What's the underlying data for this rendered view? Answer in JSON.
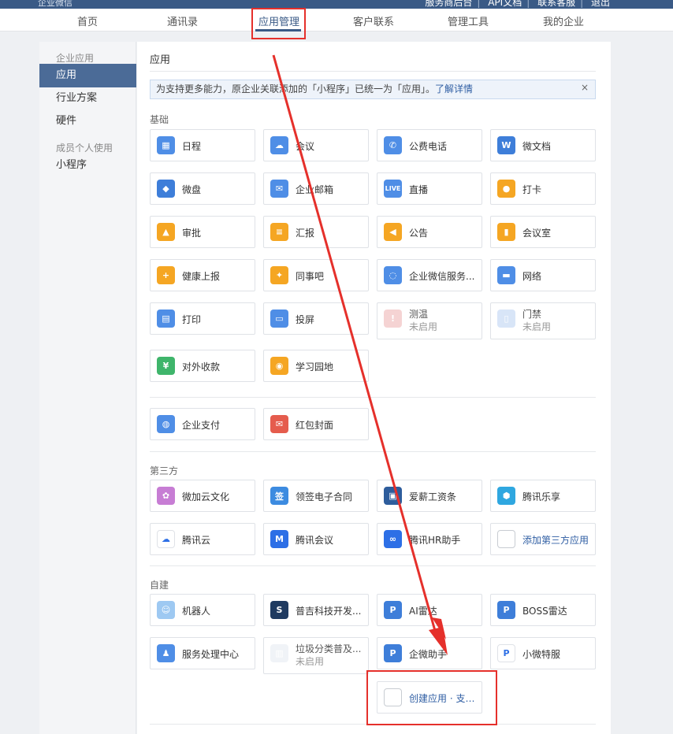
{
  "topbar": {
    "brand": "企业微信",
    "links": [
      "服务商后台",
      "API文档",
      "联系客服",
      "退出"
    ]
  },
  "nav": {
    "items": [
      "首页",
      "通讯录",
      "应用管理",
      "客户联系",
      "管理工具",
      "我的企业"
    ],
    "active": "应用管理"
  },
  "sidebar": {
    "group1": "企业应用",
    "items1": [
      "应用",
      "行业方案",
      "硬件"
    ],
    "group2": "成员个人使用",
    "items2": [
      "小程序"
    ]
  },
  "page": {
    "title": "应用",
    "notice_text": "为支持更多能力，原企业关联添加的「小程序」已统一为「应用」。",
    "notice_link": "了解详情",
    "notice_close": "×"
  },
  "sections": {
    "basic": "基础",
    "third": "第三方",
    "custom": "自建"
  },
  "apps": {
    "basic": [
      {
        "name": "日程",
        "icon": "calendar-icon",
        "color": "#4f8ee6"
      },
      {
        "name": "会议",
        "icon": "cloud-camera-icon",
        "color": "#4f8ee6"
      },
      {
        "name": "公费电话",
        "icon": "phone-icon",
        "color": "#4f8ee6"
      },
      {
        "name": "微文档",
        "icon": "doc-w-icon",
        "color": "#3e7ed9"
      },
      {
        "name": "微盘",
        "icon": "drive-icon",
        "color": "#3e7ed9"
      },
      {
        "name": "企业邮箱",
        "icon": "mail-icon",
        "color": "#4f8ee6"
      },
      {
        "name": "直播",
        "icon": "live-icon",
        "color": "#4f8ee6"
      },
      {
        "name": "打卡",
        "icon": "location-pin-icon",
        "color": "#f5a623"
      },
      {
        "name": "审批",
        "icon": "stamp-icon",
        "color": "#f5a623"
      },
      {
        "name": "汇报",
        "icon": "report-icon",
        "color": "#f5a623"
      },
      {
        "name": "公告",
        "icon": "megaphone-icon",
        "color": "#f5a623"
      },
      {
        "name": "会议室",
        "icon": "door-icon",
        "color": "#f5a623"
      },
      {
        "name": "健康上报",
        "icon": "health-report-icon",
        "color": "#f5a623"
      },
      {
        "name": "同事吧",
        "icon": "community-icon",
        "color": "#f5a623"
      },
      {
        "name": "企业微信服务...",
        "icon": "chat-service-icon",
        "color": "#4f8ee6"
      },
      {
        "name": "网络",
        "icon": "router-icon",
        "color": "#4f8ee6"
      },
      {
        "name": "打印",
        "icon": "printer-icon",
        "color": "#4f8ee6"
      },
      {
        "name": "投屏",
        "icon": "screencast-icon",
        "color": "#4f8ee6"
      },
      {
        "name": "测温",
        "sub": "未启用",
        "icon": "thermometer-icon",
        "color": "#e9a0a0"
      },
      {
        "name": "门禁",
        "sub": "未启用",
        "icon": "access-gate-icon",
        "color": "#a9c6ef"
      },
      {
        "name": "对外收款",
        "icon": "yuan-icon",
        "color": "#3fb56b"
      },
      {
        "name": "学习园地",
        "icon": "planet-icon",
        "color": "#f5a623"
      }
    ],
    "pay": [
      {
        "name": "企业支付",
        "icon": "wallet-icon",
        "color": "#4f8ee6"
      },
      {
        "name": "红包封面",
        "icon": "red-envelope-icon",
        "color": "#e55c4d"
      }
    ],
    "third": [
      {
        "name": "微加云文化",
        "icon": "flower-icon",
        "color": "#c77dd4"
      },
      {
        "name": "领签电子合同",
        "icon": "contract-icon",
        "color": "#3c8be0"
      },
      {
        "name": "爱薪工资条",
        "icon": "payslip-icon",
        "color": "#2e5d9c"
      },
      {
        "name": "腾讯乐享",
        "icon": "hexagon-icon",
        "color": "#2fa7e0"
      },
      {
        "name": "腾讯云",
        "icon": "tencent-cloud-icon",
        "color": "#ffffff"
      },
      {
        "name": "腾讯会议",
        "icon": "tencent-meeting-icon",
        "color": "#2d6fe6"
      },
      {
        "name": "腾讯HR助手",
        "icon": "hr-assistant-icon",
        "color": "#2d6fe6"
      },
      {
        "name": "添加第三方应用",
        "icon": "plus-icon",
        "color": "#ffffff",
        "link": true
      }
    ],
    "custom": [
      {
        "name": "机器人",
        "icon": "robot-icon",
        "color": "#9ec9f2"
      },
      {
        "name": "普吉科技开发...",
        "icon": "puji-logo-icon",
        "color": "#1f3a60"
      },
      {
        "name": "AI雷达",
        "icon": "radar-logo-icon",
        "color": "#3e7ed9"
      },
      {
        "name": "BOSS雷达",
        "icon": "boss-radar-icon",
        "color": "#3e7ed9"
      },
      {
        "name": "服务处理中心",
        "icon": "service-center-icon",
        "color": "#4f8ee6"
      },
      {
        "name": "垃圾分类普及...",
        "sub": "未启用",
        "icon": "garbage-chart-icon",
        "color": "#dfe6ee"
      },
      {
        "name": "企微助手",
        "icon": "assistant-logo-icon",
        "color": "#3e7ed9"
      },
      {
        "name": "小微特服",
        "icon": "special-service-icon",
        "color": "#ffffff"
      },
      {
        "name": "创建应用 · 支持...",
        "icon": "plus-icon",
        "color": "#ffffff",
        "link": true
      }
    ]
  },
  "annotation": {
    "color": "#e5302b"
  }
}
